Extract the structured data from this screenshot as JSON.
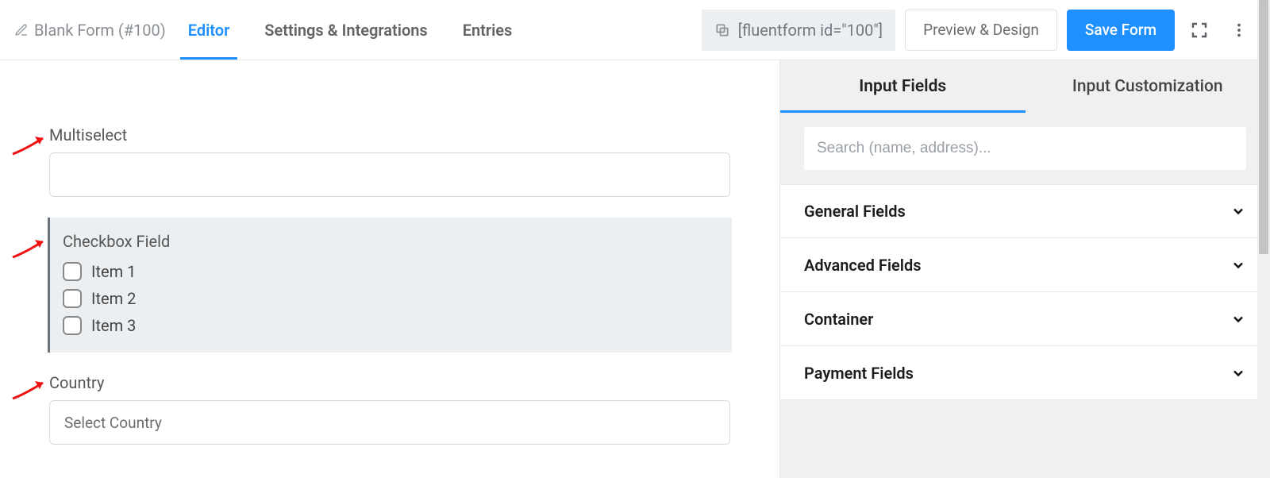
{
  "header": {
    "form_title": "Blank Form (#100)",
    "tabs": [
      "Editor",
      "Settings & Integrations",
      "Entries"
    ],
    "active_tab_index": 0,
    "shortcode": "[fluentform id=\"100\"]",
    "preview_btn": "Preview & Design",
    "save_btn": "Save Form"
  },
  "canvas": {
    "fields": {
      "multiselect": {
        "label": "Multiselect",
        "value": ""
      },
      "checkbox": {
        "label": "Checkbox Field",
        "items": [
          "Item 1",
          "Item 2",
          "Item 3"
        ]
      },
      "country": {
        "label": "Country",
        "placeholder": "Select Country"
      }
    }
  },
  "sidepanel": {
    "tabs": [
      "Input Fields",
      "Input Customization"
    ],
    "active_tab_index": 0,
    "search_placeholder": "Search (name, address)...",
    "sections": [
      "General Fields",
      "Advanced Fields",
      "Container",
      "Payment Fields"
    ]
  }
}
